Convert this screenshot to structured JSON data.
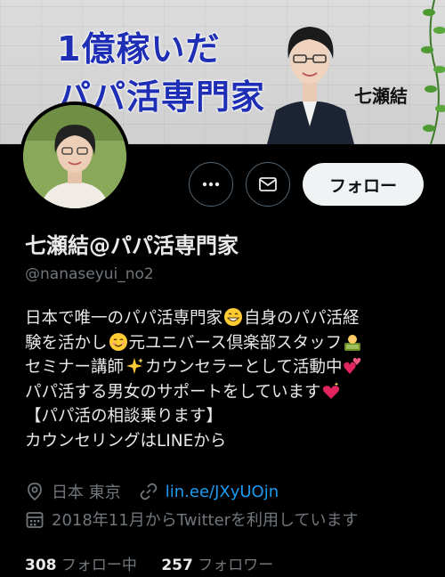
{
  "banner": {
    "headline_line1": "1億稼いだ",
    "headline_line2": "パパ活専門家",
    "name_label": "七瀬結"
  },
  "icons": [
    "more-icon",
    "mail-icon",
    "location-icon",
    "link-icon",
    "calendar-icon",
    "grin-emoji",
    "smile-emoji",
    "office-worker-emoji",
    "sparkles-emoji",
    "two-hearts-emoji",
    "sparkling-heart-emoji"
  ],
  "actions": {
    "follow_label": "フォロー"
  },
  "profile": {
    "display_name": "七瀬結@パパ活専門家",
    "handle": "@nanaseyui_no2",
    "bio": {
      "line1_a": "日本で唯一のパパ活専門家",
      "line1_b": "自身のパパ活経",
      "line2_a": "験を活かし",
      "line2_b": "元ユニバース倶楽部スタッフ",
      "line3_a": "セミナー講師",
      "line3_b": "カウンセラーとして活動中",
      "line4_a": "パパ活する男女のサポートをしています",
      "line5": "【パパ活の相談乗ります】",
      "line6": "カウンセリングはLINEから"
    },
    "location": "日本 東京",
    "link": "lin.ee/JXyUOjn",
    "joined": "2018年11月からTwitterを利用しています"
  },
  "stats": {
    "following_count": "308",
    "following_label": "フォロー中",
    "followers_count": "257",
    "followers_label": "フォロワー"
  },
  "colors": {
    "background": "#000000",
    "text": "#e7e9ea",
    "muted": "#71767b",
    "link": "#1d9bf0",
    "banner_text": "#1f2fb5",
    "follow_button_bg": "#eff3f4"
  }
}
